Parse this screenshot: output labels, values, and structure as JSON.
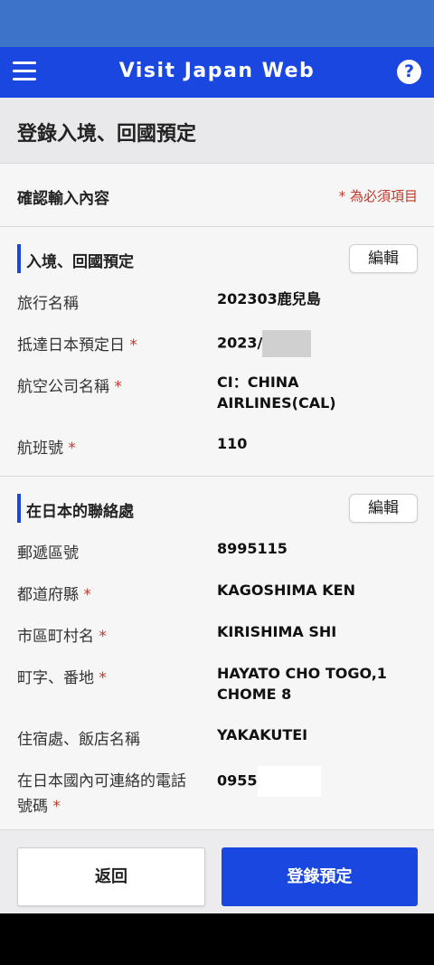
{
  "app": {
    "title": "Visit Japan Web",
    "help_label": "?"
  },
  "page": {
    "title": "登錄入境、回國預定"
  },
  "confirm": {
    "title": "確認輸入內容",
    "required_note": "* 為必須項目"
  },
  "sections": [
    {
      "title": "入境、回國預定",
      "edit_label": "編輯",
      "fields": [
        {
          "label": "旅行名稱",
          "required": false,
          "value": "202303鹿兒島"
        },
        {
          "label": "抵達日本預定日",
          "required": true,
          "value": "2023/"
        },
        {
          "label": "航空公司名稱",
          "required": true,
          "value": "CI：CHINA AIRLINES(CAL)"
        },
        {
          "label": "航班號",
          "required": true,
          "value": "110"
        }
      ]
    },
    {
      "title": "在日本的聯絡處",
      "edit_label": "編輯",
      "fields": [
        {
          "label": "郵遞區號",
          "required": false,
          "value": "8995115"
        },
        {
          "label": "都道府縣",
          "required": true,
          "value": "KAGOSHIMA KEN"
        },
        {
          "label": "市區町村名",
          "required": true,
          "value": "KIRISHIMA SHI"
        },
        {
          "label": "町字、番地",
          "required": true,
          "value": "HAYATO CHO TOGO,1 CHOME 8"
        },
        {
          "label": "住宿處、飯店名稱",
          "required": false,
          "value": "YAKAKUTEI"
        },
        {
          "label": "在日本國內可連絡的電話號碼",
          "required": true,
          "value": "0955"
        }
      ]
    }
  ],
  "required_mark": "*",
  "footer": {
    "back_label": "返回",
    "submit_label": "登錄預定"
  }
}
